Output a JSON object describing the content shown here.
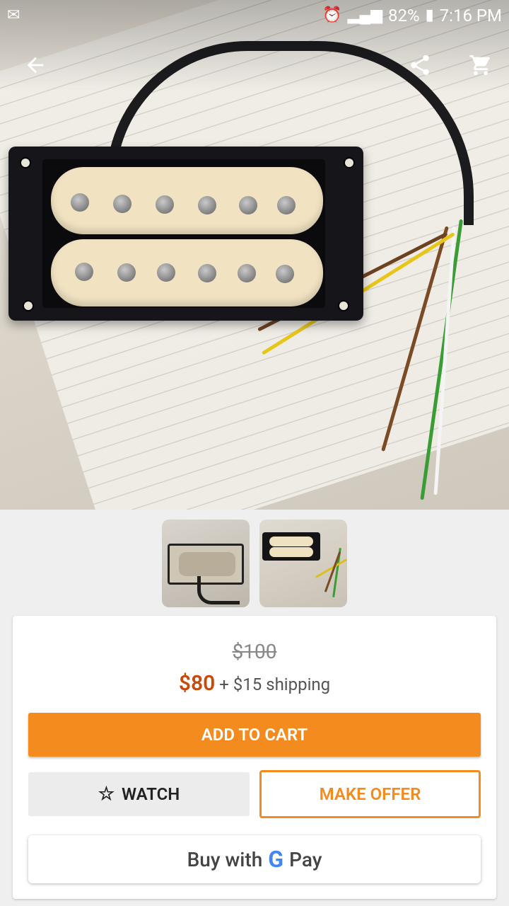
{
  "status_bar": {
    "time": "7:16 PM",
    "battery": "82%"
  },
  "toolbar": {
    "back": "back-arrow-icon",
    "share": "share-icon",
    "cart": "cart-icon"
  },
  "pricing": {
    "original_price": "$100",
    "price": "$80",
    "shipping": "+ $15 shipping"
  },
  "actions": {
    "add_to_cart": "ADD TO CART",
    "watch": "WATCH",
    "make_offer": "MAKE OFFER",
    "buy_with": "Buy with",
    "pay": "Pay"
  },
  "colors": {
    "accent": "#f38b1e",
    "price": "#c44b0c"
  }
}
